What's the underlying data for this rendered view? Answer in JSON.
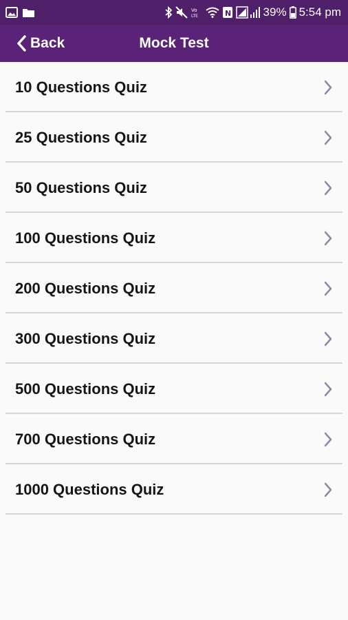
{
  "status_bar": {
    "battery_text": "39%",
    "time": "5:54 pm",
    "icons": [
      "gallery-icon",
      "folder-icon",
      "bluetooth-icon",
      "mute-icon",
      "volte-icon",
      "wifi-icon",
      "nfc-icon",
      "signal-icon",
      "battery-icon"
    ]
  },
  "nav": {
    "back_label": "Back",
    "title": "Mock Test"
  },
  "colors": {
    "status_bar_bg": "#4f1f6a",
    "nav_bg": "#5b2377",
    "chevron": "#8a8aa8",
    "divider": "#d6d6d6"
  },
  "quizzes": [
    {
      "label": "10 Questions Quiz"
    },
    {
      "label": "25 Questions Quiz"
    },
    {
      "label": "50 Questions Quiz"
    },
    {
      "label": "100 Questions Quiz"
    },
    {
      "label": "200 Questions Quiz"
    },
    {
      "label": "300 Questions Quiz"
    },
    {
      "label": "500 Questions Quiz"
    },
    {
      "label": "700 Questions Quiz"
    },
    {
      "label": "1000 Questions Quiz"
    }
  ]
}
